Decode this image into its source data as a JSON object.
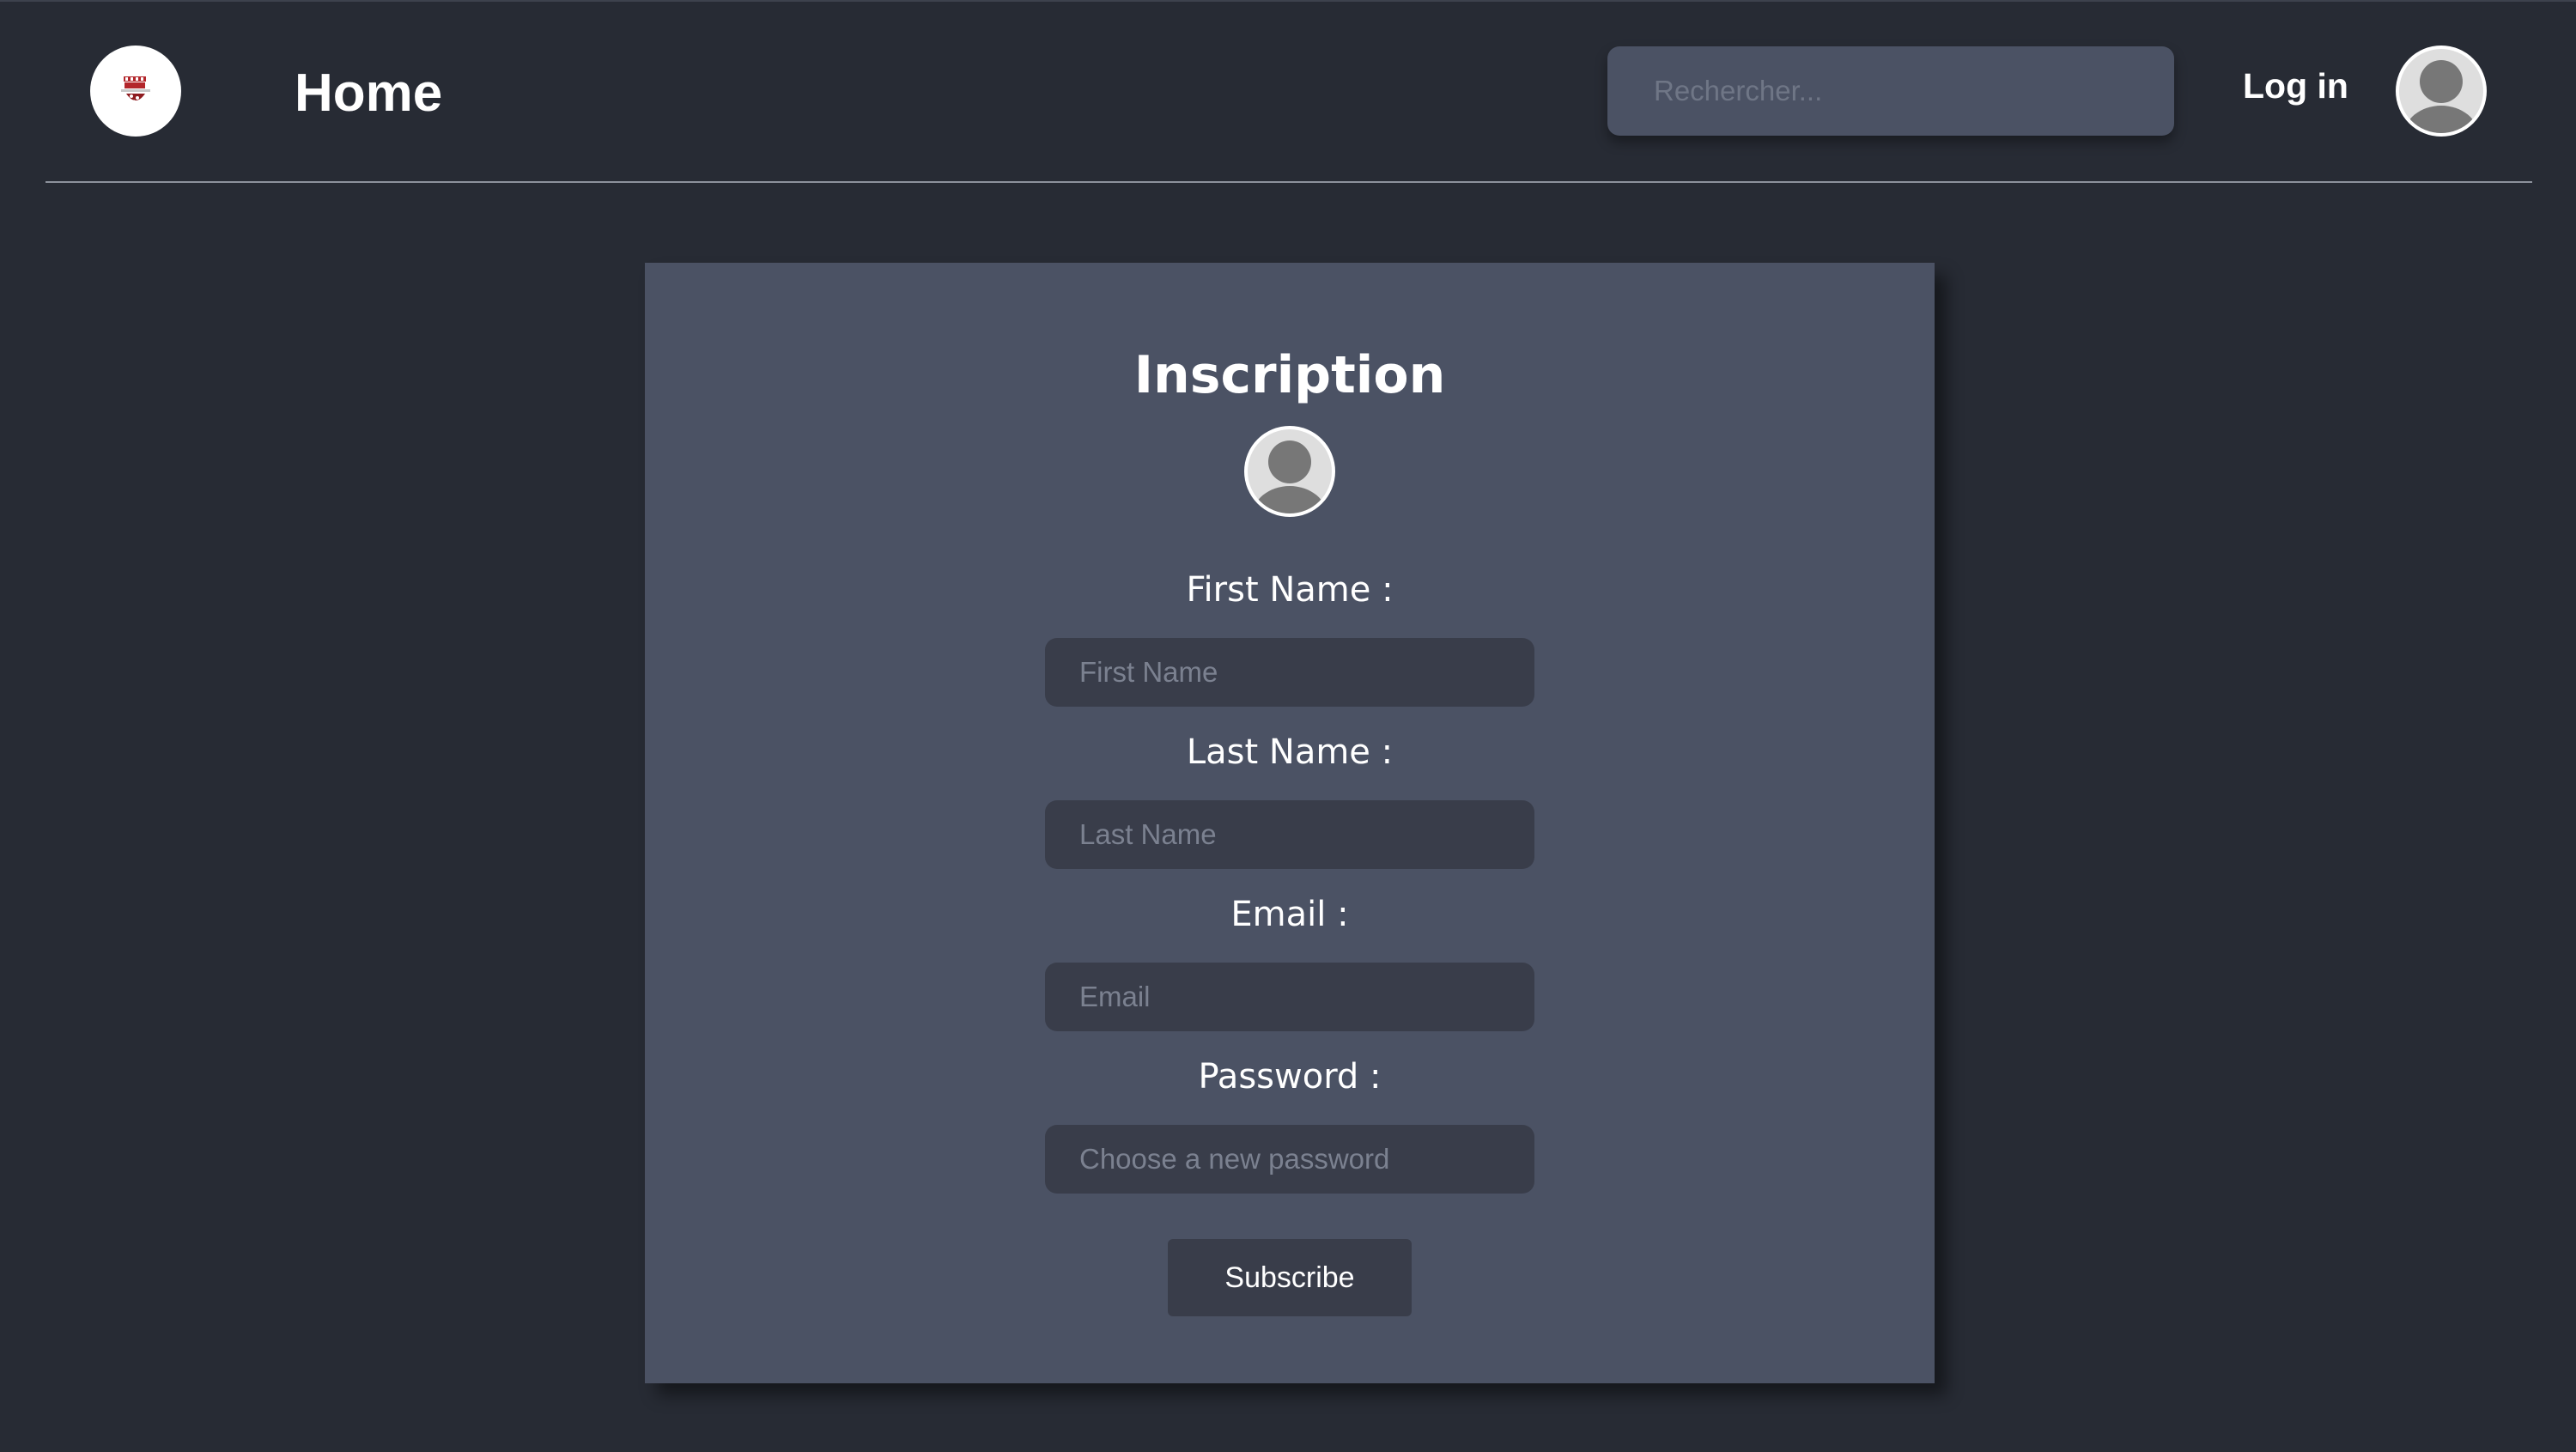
{
  "header": {
    "logo_icon": "film-clapper-popcorn-logo",
    "title": "Home",
    "search": {
      "placeholder": "Rechercher...",
      "value": ""
    },
    "login_label": "Log in",
    "avatar_icon": "user-avatar-icon"
  },
  "form": {
    "title": "Inscription",
    "avatar_icon": "user-avatar-icon",
    "fields": [
      {
        "label": "First Name :",
        "placeholder": "First Name",
        "value": ""
      },
      {
        "label": "Last Name :",
        "placeholder": "Last Name",
        "value": ""
      },
      {
        "label": "Email :",
        "placeholder": "Email",
        "value": ""
      },
      {
        "label": "Password :",
        "placeholder": "Choose a new password",
        "value": ""
      }
    ],
    "submit_label": "Subscribe"
  },
  "colors": {
    "page_background": "#272b34",
    "card_background": "#4b5264",
    "input_background": "#393d4a",
    "text": "#ffffff",
    "logo_accent": "#b3262b"
  }
}
